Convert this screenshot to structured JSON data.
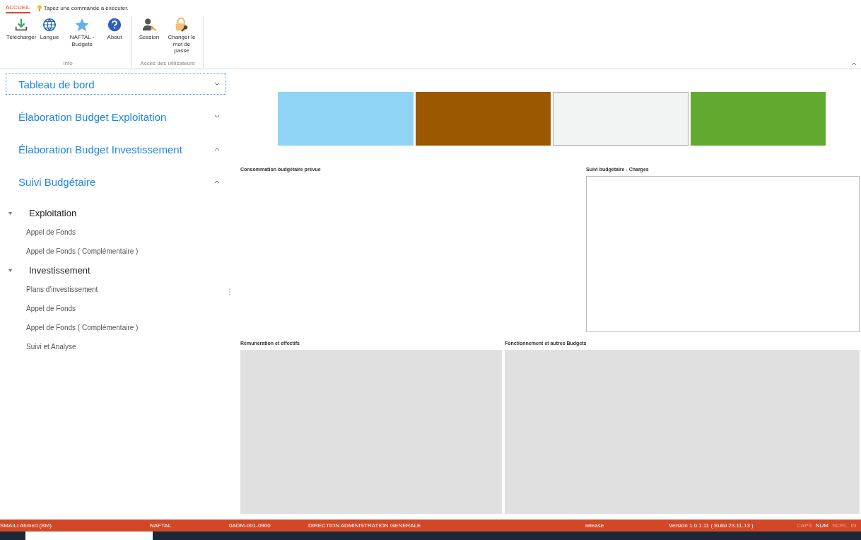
{
  "ribbon": {
    "tabs": [
      {
        "label": "ACCUEIL",
        "selected": true
      }
    ],
    "tell_me": "Tapez une commande à exécuter.",
    "groups": [
      {
        "label": "Info",
        "buttons": [
          {
            "label": "Télécharger",
            "kind": "download"
          },
          {
            "label": "Langue",
            "kind": "globe"
          },
          {
            "label": "NAFTAL - Budgets",
            "kind": "star"
          },
          {
            "label": "About",
            "kind": "help"
          }
        ]
      },
      {
        "label": "Accès des utilisateurs",
        "buttons": [
          {
            "label": "Session",
            "kind": "user"
          },
          {
            "label": "Changer le mot de passe",
            "kind": "lock"
          }
        ]
      }
    ]
  },
  "sidebar": {
    "groups": [
      {
        "title": "Tableau de bord",
        "selected": true,
        "expanded": false
      },
      {
        "title": "Élaboration Budget Exploitation",
        "selected": false,
        "expanded": false
      },
      {
        "title": "Élaboration Budget Investissement",
        "selected": false,
        "expanded": true
      },
      {
        "title": "Suivi Budgétaire",
        "selected": false,
        "expanded": true,
        "children": [
          {
            "label": "Exploitation",
            "expanded": true,
            "children": [
              {
                "label": "Appel de Fonds"
              },
              {
                "label": "Appel de Fonds ( Complémentaire )"
              }
            ]
          },
          {
            "label": "Investissement",
            "expanded": true,
            "children": [
              {
                "label": "Plans d'investissement"
              },
              {
                "label": "Appel de Fonds"
              },
              {
                "label": "Appel de Fonds ( Complémentaire )"
              },
              {
                "label": "Suivi et Analyse"
              }
            ]
          }
        ]
      }
    ]
  },
  "tiles": [
    {
      "color": "#8fd4f5"
    },
    {
      "color": "#9c5800"
    },
    {
      "color": "#f2f4f4"
    },
    {
      "color": "#62a930"
    }
  ],
  "panels": {
    "consumption": "Consommation budgétaire prévue",
    "charges": "Suivi budgétaire - Charges",
    "remuneration": "Rémunération et effectifs",
    "functioning": "Fonctionnement et autres Budgets"
  },
  "status_bar": {
    "fields": [
      "SMAILI Ahmed (BM)",
      "NAFTAL",
      "0ADM-001-0900",
      "DIRECTION ADMINISTRATION GENERALE",
      "release",
      "Version 1.0.1.11 ( Build 23.11.13 )"
    ],
    "keys": [
      {
        "label": "CAPS",
        "active": false
      },
      {
        "label": "NUM",
        "active": true
      },
      {
        "label": "SCRL",
        "active": false
      },
      {
        "label": "IN",
        "active": false
      }
    ]
  }
}
